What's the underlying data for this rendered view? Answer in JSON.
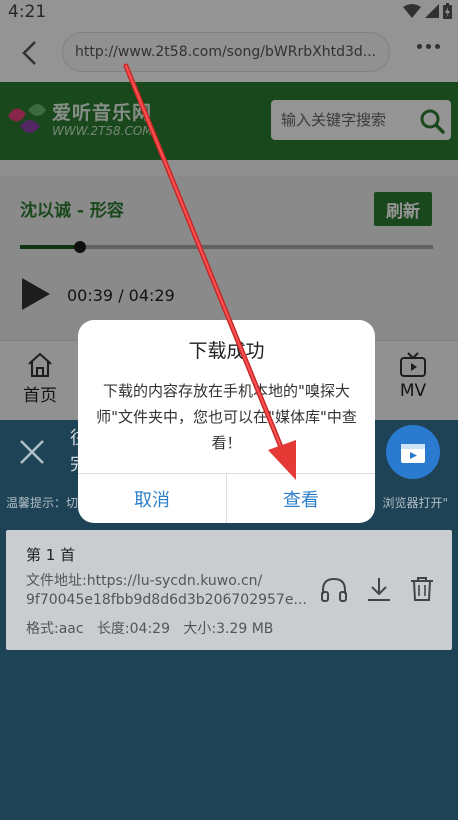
{
  "status_bar": {
    "time": "4:21"
  },
  "browser": {
    "url": "http://www.2t58.com/song/bWRrbXhtd3d..."
  },
  "site": {
    "logo_text": "爱听音乐网",
    "logo_sub": "WWW.2T58.COM",
    "search_placeholder": "输入关键字搜索"
  },
  "player": {
    "song_title": "沈以诚 - 形容",
    "refresh_label": "刷新",
    "time": "00:39 / 04:29",
    "progress": 0.145
  },
  "nav": {
    "home_label": "首页",
    "mv_label": "MV"
  },
  "bottom_panel": {
    "title_line1": "往",
    "title_line2": "完",
    "tip": "温馨提示：",
    "tip_mid": "切",
    "tip_right": "浏览器打开\"",
    "file": {
      "index": "第 1 首",
      "address": "文件地址:https://lu-sycdn.kuwo.cn/",
      "address2": "9f70045e18fbb9d8d6d3b206702957e...",
      "format": "格式:aac",
      "length": "长度:04:29",
      "size": "大小:3.29 MB"
    }
  },
  "dialog": {
    "title": "下载成功",
    "message": "下载的内容存放在手机本地的\"嗅探大师\"文件夹中，您也可以在\"媒体库\"中查看！",
    "cancel_label": "取消",
    "view_label": "查看"
  },
  "colors": {
    "brand_green": "#2e7d32",
    "dialog_button": "#2f80c9",
    "panel": "#1f4356",
    "arrow": "#e53935"
  }
}
